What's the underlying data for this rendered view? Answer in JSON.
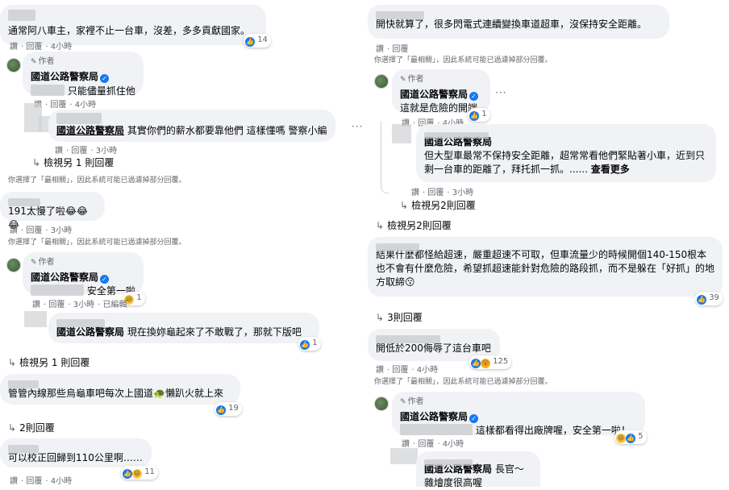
{
  "common": {
    "like": "讚",
    "reply": "回覆",
    "edited": "已編輯",
    "author": "作者",
    "page_name": "國道公路警察局",
    "filter_note": "你選擇了「最相關」，因此系統可能已過濾掉部分回覆。"
  },
  "left": {
    "c1": {
      "text": "通常阿八車主，家裡不止一台車，沒差，多多貢獻國家。",
      "time": "4小時",
      "count": "14"
    },
    "c1_r1": {
      "text": "只能儘量抓住他",
      "time": "4小時"
    },
    "c1_r2": {
      "text": "其實你們的薪水都要靠他們 這樣懂嗎 警察小編",
      "time": "3小時"
    },
    "c1_more": "檢視另 1 則回覆",
    "c2": {
      "text": "191太慢了啦😂😂😂",
      "time": "3小時"
    },
    "c2_r1": {
      "text": "安全第一啦",
      "time": "3小時",
      "count": "1"
    },
    "c2_r2": {
      "text": "現在換妳龜起來了不敢戰了，那就下版吧",
      "count": "1"
    },
    "c2_more": "檢視另 1 則回覆",
    "c3": {
      "text": "管管內線那些烏龜車吧每次上國道🐢懶趴火就上來",
      "count": "19"
    },
    "c3_more": "2則回覆",
    "c4": {
      "text": "可以校正回歸到110公里啊……",
      "time": "4小時",
      "count": "11"
    }
  },
  "right": {
    "c1": {
      "text": "開快就算了，很多閃電式連續變換車道超車，沒保持安全距離。"
    },
    "c1_r1": {
      "text": "這就是危險的開端",
      "time": "4小時",
      "count": "1"
    },
    "c1_r2": {
      "text": "但大型車最常不保持安全距離，超常常看他們緊貼著小車，近到只剩一台車的距離了，拜托抓一抓。......",
      "see_more": "查看更多",
      "time": "3小時"
    },
    "c1_more": "檢視另2則回覆",
    "c2": {
      "text": "結果什麼都怪給超速，嚴重超速不可取，但車流量少的時候開個140-150根本也不會有什麼危險，希望抓超速能針對危險的路段抓，而不是躲在「好抓」的地方取締😗",
      "count": "39"
    },
    "c2_more": "3則回覆",
    "c3": {
      "text": "開低於200侮辱了這台車吧",
      "time": "4小時",
      "count": "125"
    },
    "c3_r1": {
      "text": "這樣都看得出廠牌喔，安全第一啦！",
      "time": "4小時",
      "count": "5"
    },
    "c3_r2": {
      "text": "長官～",
      "tail": "雜燴度很高喔"
    }
  }
}
